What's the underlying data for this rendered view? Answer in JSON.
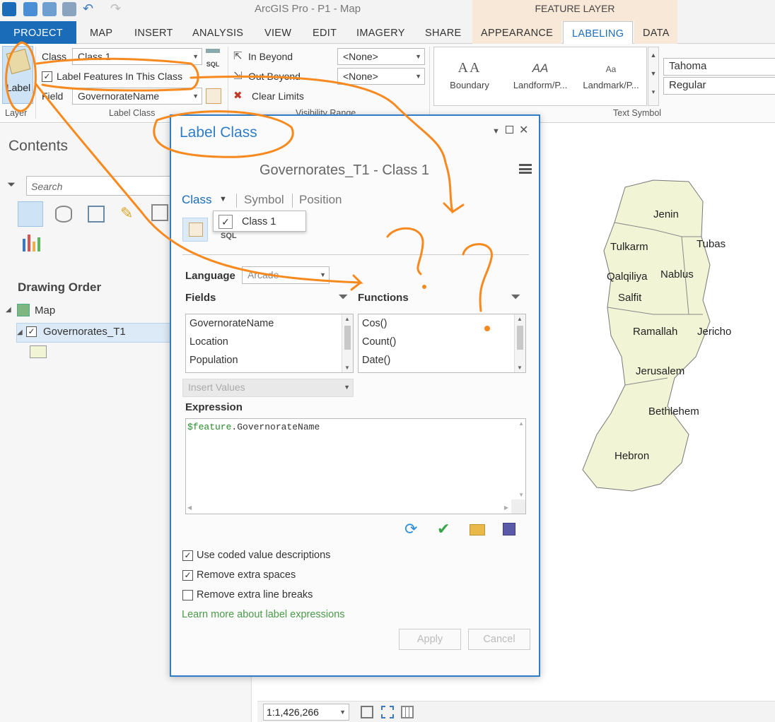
{
  "window": {
    "title": "ArcGIS Pro - P1 - Map",
    "contextual_tab_group": "FEATURE LAYER"
  },
  "tabs": [
    "PROJECT",
    "MAP",
    "INSERT",
    "ANALYSIS",
    "VIEW",
    "EDIT",
    "IMAGERY",
    "SHARE",
    "APPEARANCE",
    "LABELING",
    "DATA"
  ],
  "ribbon": {
    "layer_group": {
      "label_button": "Label",
      "group_label": "Layer"
    },
    "label_class_group": {
      "class_label": "Class",
      "class_value": "Class 1",
      "label_features_checkbox": "Label Features In This Class",
      "field_label": "Field",
      "field_value": "GovernorateName",
      "group_label": "Label Class",
      "sql_label": "SQL"
    },
    "visibility_group": {
      "in_beyond": "In Beyond",
      "out_beyond": "Out Beyond",
      "clear_limits": "Clear Limits",
      "in_value": "<None>",
      "out_value": "<None>",
      "group_label": "Visibility Range"
    },
    "text_symbol_group": {
      "gallery": [
        {
          "sample": "AA",
          "name": "Boundary"
        },
        {
          "sample": "AA",
          "name": "Landform/P..."
        },
        {
          "sample": "Aa",
          "name": "Landmark/P..."
        }
      ],
      "font": "Tahoma",
      "style": "Regular",
      "group_label": "Text Symbol"
    }
  },
  "contents": {
    "title": "Contents",
    "search_placeholder": "Search",
    "section": "Drawing Order",
    "tree": {
      "map": "Map",
      "layer": "Governorates_T1"
    }
  },
  "dialog": {
    "title": "Label Class",
    "subtitle": "Governorates_T1 - Class 1",
    "tabs": [
      "Class",
      "Symbol",
      "Position"
    ],
    "class_dropdown_item": "Class 1",
    "sql_label": "SQL",
    "language_label": "Language",
    "language_value": "Arcade",
    "fields_label": "Fields",
    "functions_label": "Functions",
    "fields": [
      "GovernorateName",
      "Location",
      "Population"
    ],
    "functions": [
      "Cos()",
      "Count()",
      "Date()"
    ],
    "insert_values": "Insert Values",
    "expression_label": "Expression",
    "expression": {
      "prefix": "$feature",
      "suffix": ".GovernorateName"
    },
    "options": [
      {
        "label": "Use coded value descriptions",
        "checked": true
      },
      {
        "label": "Remove extra spaces",
        "checked": true
      },
      {
        "label": "Remove extra line breaks",
        "checked": false
      }
    ],
    "learn_more": "Learn more about label expressions",
    "apply": "Apply",
    "cancel": "Cancel"
  },
  "map": {
    "labels": [
      "Jenin",
      "Tulkarm",
      "Tubas",
      "Qalqiliya",
      "Nablus",
      "Salfit",
      "Ramallah",
      "Jericho",
      "Jerusalem",
      "Bethlehem",
      "Hebron"
    ]
  },
  "status": {
    "scale": "1:1,426,266"
  },
  "colors": {
    "accent": "#1a6cb8",
    "contextual": "#f8e8d8",
    "map_fill": "#f1f5d6",
    "annotation": "#f7891f",
    "link": "#4a9a4a"
  }
}
